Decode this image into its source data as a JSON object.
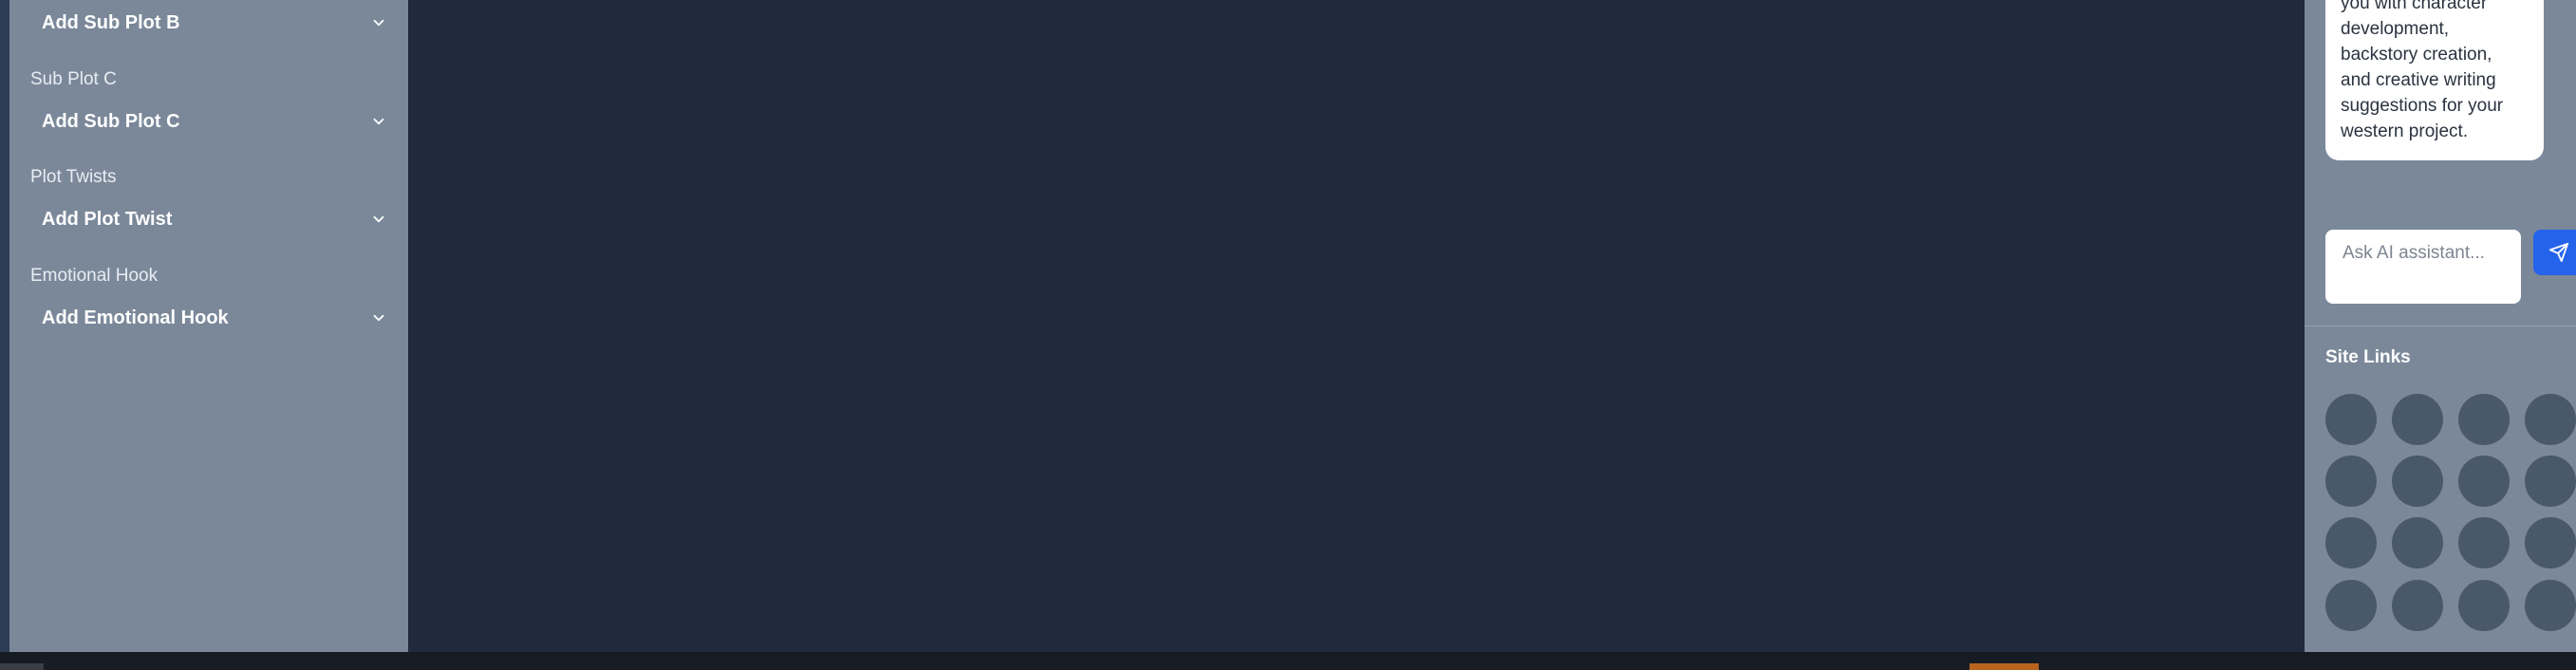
{
  "left_sidebar": {
    "items": [
      {
        "section_label": "",
        "dropdown_label": "Add Sub Plot B"
      },
      {
        "section_label": "Sub Plot C",
        "dropdown_label": "Add Sub Plot C"
      },
      {
        "section_label": "Plot Twists",
        "dropdown_label": "Add Plot Twist"
      },
      {
        "section_label": "Emotional Hook",
        "dropdown_label": "Add Emotional Hook"
      }
    ]
  },
  "assistant": {
    "message_lines": [
      "you with character",
      "development,",
      "backstory creation,",
      "and creative writing",
      "suggestions for your",
      "western project."
    ],
    "input_placeholder": "Ask AI assistant..."
  },
  "site_links": {
    "title": "Site Links",
    "count": 16
  },
  "colors": {
    "main_bg": "#1f2a3c",
    "sidebar_bg": "#7a8899",
    "send_button": "#2563eb",
    "link_circle": "#4a586c",
    "taskbar_accent": "#b8641f"
  },
  "icons": {
    "dropdown": "chevron-down-icon",
    "send": "send-icon"
  }
}
